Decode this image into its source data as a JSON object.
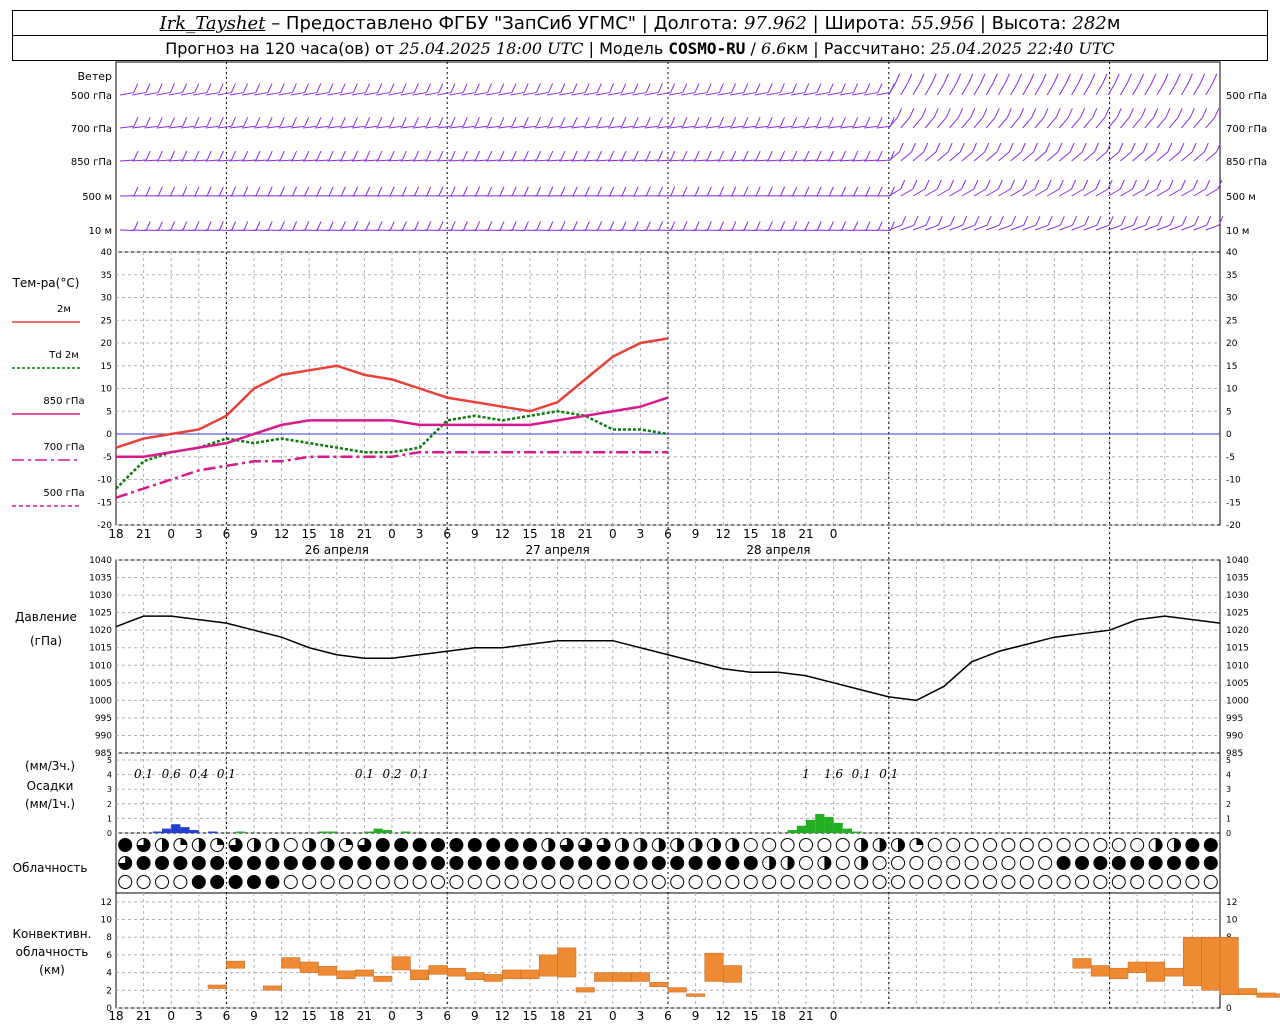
{
  "header": {
    "station": "Irk_Tayshet",
    "provided_by": "– Предоставлено ФГБУ \"ЗапСиб УГМС\"",
    "lon_label": "Долгота:",
    "lon_value": "97.962",
    "lat_label": "Широта:",
    "lat_value": "55.956",
    "alt_label": "Высота:",
    "alt_value": "282",
    "alt_unit": "м",
    "forecast_label": "Прогноз на 120 часа(ов) от",
    "forecast_start": "25.04.2025 18:00 UTC",
    "model_label": "Модель",
    "model_name": "COSMO-RU",
    "model_res": "6.6",
    "model_res_unit": "км",
    "calc_label": "Рассчитано:",
    "calc_time": "25.04.2025 22:40 UTC"
  },
  "labels": {
    "wind_title": "Ветер",
    "wind_levels": [
      "500 гПа",
      "700 гПа",
      "850 гПа",
      "500 м",
      "10 м"
    ],
    "temp_title": "Тем-ра(°C)",
    "temp_legend": [
      {
        "text": "2м",
        "color": "#e8413a",
        "dash": ""
      },
      {
        "text": "2м",
        "prefix": "Td",
        "color": "#0a7a0a",
        "dash": "3,2"
      },
      {
        "text": "850 гПа",
        "color": "#d81b8c",
        "dash": ""
      },
      {
        "text": "700 гПа",
        "color": "#d81b8c",
        "dash": "12,4,3,4"
      },
      {
        "text": "500 гПа",
        "color": "#d81b8c",
        "dash": "4,3"
      }
    ],
    "pressure_title": "Давление",
    "pressure_unit": "(гПа)",
    "precip_unit_3h": "(мм/3ч.)",
    "precip_title": "Осадки",
    "precip_unit_1h": "(мм/1ч.)",
    "cloud_title": "Облачность",
    "conv_title": [
      "Конвективн.",
      "облачность",
      "(км)"
    ],
    "hour_ticks": [
      "18",
      "21",
      "0",
      "3",
      "6",
      "9",
      "12",
      "15",
      "18",
      "21",
      "0",
      "3",
      "6",
      "9",
      "12",
      "15",
      "18",
      "21",
      "0",
      "3",
      "6",
      "9",
      "12",
      "15",
      "18",
      "21",
      "0"
    ],
    "day_labels": [
      {
        "text": "26 апреля",
        "at_index": 8
      },
      {
        "text": "27 апреля",
        "at_index": 16
      },
      {
        "text": "28 апреля",
        "at_index": 24
      }
    ]
  },
  "chart_data": [
    {
      "type": "wind-barbs",
      "title": "Ветер",
      "levels": [
        "500 гПа",
        "700 гПа",
        "850 гПа",
        "500 м",
        "10 м"
      ],
      "x_hours": [
        0,
        60
      ]
    },
    {
      "type": "line",
      "title": "Тем-ра(°C)",
      "ylim": [
        -20,
        40
      ],
      "yticks": [
        -20,
        -15,
        -10,
        -5,
        0,
        5,
        10,
        15,
        20,
        25,
        30,
        35,
        40
      ],
      "x_hours": [
        0,
        60
      ],
      "series": [
        {
          "name": "2м",
          "color": "#e8413a",
          "x": [
            0,
            3,
            6,
            9,
            12,
            15,
            18,
            21,
            24,
            27,
            30,
            33,
            36,
            39,
            42,
            45,
            48,
            51,
            54,
            57,
            60
          ],
          "y": [
            -3,
            -1,
            0,
            1,
            4,
            10,
            13,
            14,
            15,
            13,
            12,
            10,
            8,
            7,
            6,
            5,
            7,
            12,
            17,
            20,
            21
          ]
        },
        {
          "name": "Td 2м",
          "color": "#0a7a0a",
          "x": [
            0,
            3,
            6,
            9,
            12,
            15,
            18,
            21,
            24,
            27,
            30,
            33,
            36,
            39,
            42,
            45,
            48,
            51,
            54,
            57,
            60
          ],
          "y": [
            -12,
            -6,
            -4,
            -3,
            -1,
            -2,
            -1,
            -2,
            -3,
            -4,
            -4,
            -3,
            3,
            4,
            3,
            4,
            5,
            4,
            1,
            1,
            0
          ]
        },
        {
          "name": "850 гПа",
          "color": "#d81b8c",
          "x": [
            0,
            3,
            6,
            9,
            12,
            15,
            18,
            21,
            24,
            27,
            30,
            33,
            36,
            39,
            42,
            45,
            48,
            51,
            54,
            57,
            60
          ],
          "y": [
            -5,
            -5,
            -4,
            -3,
            -2,
            0,
            2,
            3,
            3,
            3,
            3,
            2,
            2,
            2,
            2,
            2,
            3,
            4,
            5,
            6,
            8
          ]
        },
        {
          "name": "700 гПа",
          "color": "#d81b8c",
          "x": [
            0,
            3,
            6,
            9,
            12,
            15,
            18,
            21,
            24,
            27,
            30,
            33,
            36,
            39,
            42,
            45,
            48,
            51,
            54,
            57,
            60
          ],
          "y": [
            -14,
            -12,
            -10,
            -8,
            -7,
            -6,
            -6,
            -5,
            -5,
            -5,
            -5,
            -4,
            -4,
            -4,
            -4,
            -4,
            -4,
            -4,
            -4,
            -4,
            -4
          ]
        },
        {
          "name": "500 гПа",
          "color": "#d81b8c",
          "x": [],
          "y": []
        }
      ]
    },
    {
      "type": "line",
      "title": "Давление",
      "ylabel": "(гПа)",
      "ylim": [
        985,
        1040
      ],
      "yticks": [
        985,
        990,
        995,
        1000,
        1005,
        1010,
        1015,
        1020,
        1025,
        1030,
        1035,
        1040
      ],
      "series": [
        {
          "name": "Давление",
          "color": "#000000",
          "x": [
            0,
            3,
            6,
            9,
            12,
            15,
            18,
            21,
            24,
            27,
            30,
            33,
            36,
            39,
            42,
            45,
            48,
            51,
            54,
            57,
            60,
            63,
            66,
            69,
            72,
            75,
            78,
            81,
            84,
            87,
            90,
            93,
            96,
            99,
            102,
            105,
            108,
            111,
            114,
            117,
            120
          ],
          "y": [
            1021,
            1024,
            1024,
            1023,
            1022,
            1020,
            1018,
            1015,
            1013,
            1012,
            1012,
            1013,
            1014,
            1015,
            1015,
            1016,
            1017,
            1017,
            1017,
            1015,
            1013,
            1011,
            1009,
            1008,
            1008,
            1007,
            1005,
            1003,
            1001,
            1000,
            1004,
            1011,
            1014,
            1016,
            1018,
            1019,
            1020,
            1023,
            1024,
            1023,
            1022
          ]
        }
      ]
    },
    {
      "type": "bar",
      "title": "Осадки",
      "ylim": [
        0,
        5
      ],
      "yticks": [
        0,
        1,
        2,
        3,
        4,
        5
      ],
      "amount_labels": [
        {
          "hour": 3,
          "text": "0.1"
        },
        {
          "hour": 6,
          "text": "0.6"
        },
        {
          "hour": 9,
          "text": "0.4"
        },
        {
          "hour": 12,
          "text": "0.1"
        },
        {
          "hour": 27,
          "text": "0.1"
        },
        {
          "hour": 30,
          "text": "0.2"
        },
        {
          "hour": 33,
          "text": "0.1"
        },
        {
          "hour": 75,
          "text": "1"
        },
        {
          "hour": 78,
          "text": "1.6"
        },
        {
          "hour": 81,
          "text": "0.1"
        },
        {
          "hour": 84,
          "text": "0.1"
        }
      ],
      "bars": [
        {
          "hour": 4,
          "value": 0.1,
          "color": "#1e3fd0"
        },
        {
          "hour": 5,
          "value": 0.3,
          "color": "#1e3fd0"
        },
        {
          "hour": 6,
          "value": 0.6,
          "color": "#1e3fd0"
        },
        {
          "hour": 7,
          "value": 0.4,
          "color": "#1e3fd0"
        },
        {
          "hour": 8,
          "value": 0.2,
          "color": "#1e3fd0"
        },
        {
          "hour": 10,
          "value": 0.1,
          "color": "#1e3fd0"
        },
        {
          "hour": 13,
          "value": 0.1,
          "color": "#22b022"
        },
        {
          "hour": 22,
          "value": 0.1,
          "color": "#22b022"
        },
        {
          "hour": 23,
          "value": 0.1,
          "color": "#22b022"
        },
        {
          "hour": 27,
          "value": 0.1,
          "color": "#22b022"
        },
        {
          "hour": 28,
          "value": 0.3,
          "color": "#22b022"
        },
        {
          "hour": 29,
          "value": 0.2,
          "color": "#22b022"
        },
        {
          "hour": 31,
          "value": 0.1,
          "color": "#22b022"
        },
        {
          "hour": 73,
          "value": 0.2,
          "color": "#22b022"
        },
        {
          "hour": 74,
          "value": 0.5,
          "color": "#22b022"
        },
        {
          "hour": 75,
          "value": 0.9,
          "color": "#22b022"
        },
        {
          "hour": 76,
          "value": 1.3,
          "color": "#22b022"
        },
        {
          "hour": 77,
          "value": 1.1,
          "color": "#22b022"
        },
        {
          "hour": 78,
          "value": 0.7,
          "color": "#22b022"
        },
        {
          "hour": 79,
          "value": 0.3,
          "color": "#22b022"
        },
        {
          "hour": 80,
          "value": 0.1,
          "color": "#22b022"
        }
      ]
    },
    {
      "type": "heatmap",
      "title": "Облачность",
      "rows": 3,
      "cols": 60,
      "note": "cloud cover symbols: 0 empty, 1 quarter, 2 half, 3 three-quarter, 4 full",
      "row_values": [
        [
          4,
          3,
          2,
          1,
          2,
          1,
          3,
          2,
          2,
          0,
          2,
          2,
          1,
          3,
          4,
          4,
          4,
          4,
          4,
          4,
          4,
          4,
          4,
          2,
          3,
          3,
          3,
          2,
          2,
          2,
          2,
          2,
          2,
          2,
          0,
          0,
          0,
          0,
          0,
          0,
          2,
          2,
          2,
          1,
          0,
          0,
          0,
          0,
          0,
          0,
          0,
          0,
          0,
          0,
          0,
          0,
          2,
          2,
          4,
          4
        ],
        [
          3,
          4,
          4,
          4,
          4,
          4,
          4,
          4,
          4,
          4,
          4,
          4,
          4,
          4,
          4,
          4,
          4,
          4,
          4,
          4,
          4,
          4,
          4,
          4,
          4,
          4,
          4,
          4,
          4,
          4,
          4,
          4,
          4,
          4,
          4,
          2,
          2,
          0,
          2,
          0,
          2,
          0,
          0,
          0,
          0,
          0,
          0,
          0,
          0,
          0,
          0,
          4,
          4,
          4,
          4,
          4,
          4,
          4,
          4,
          4
        ],
        [
          0,
          0,
          0,
          0,
          4,
          4,
          4,
          4,
          4,
          0,
          0,
          0,
          0,
          0,
          0,
          0,
          0,
          0,
          0,
          0,
          0,
          0,
          0,
          0,
          0,
          0,
          0,
          0,
          0,
          0,
          0,
          0,
          0,
          0,
          0,
          0,
          0,
          0,
          0,
          0,
          0,
          0,
          0,
          0,
          0,
          0,
          0,
          0,
          0,
          0,
          0,
          0,
          0,
          0,
          0,
          0,
          0,
          0,
          0,
          0
        ]
      ]
    },
    {
      "type": "bar",
      "title": "Конвективн. облачность (км)",
      "ylim": [
        0,
        13
      ],
      "yticks": [
        0,
        2,
        4,
        6,
        8,
        10,
        12
      ],
      "bars": [
        {
          "hour": 5,
          "base": 2.2,
          "top": 2.6
        },
        {
          "hour": 6,
          "base": 4.5,
          "top": 5.3
        },
        {
          "hour": 8,
          "base": 2.0,
          "top": 2.5
        },
        {
          "hour": 9,
          "base": 4.5,
          "top": 5.7
        },
        {
          "hour": 10,
          "base": 4.0,
          "top": 5.2
        },
        {
          "hour": 11,
          "base": 3.7,
          "top": 4.7
        },
        {
          "hour": 12,
          "base": 3.3,
          "top": 4.2
        },
        {
          "hour": 13,
          "base": 3.6,
          "top": 4.3
        },
        {
          "hour": 14,
          "base": 3.0,
          "top": 3.6
        },
        {
          "hour": 15,
          "base": 4.3,
          "top": 5.8
        },
        {
          "hour": 16,
          "base": 3.2,
          "top": 4.3
        },
        {
          "hour": 17,
          "base": 3.8,
          "top": 4.8
        },
        {
          "hour": 18,
          "base": 3.6,
          "top": 4.5
        },
        {
          "hour": 19,
          "base": 3.2,
          "top": 4.0
        },
        {
          "hour": 20,
          "base": 3.0,
          "top": 3.8
        },
        {
          "hour": 21,
          "base": 3.3,
          "top": 4.3
        },
        {
          "hour": 22,
          "base": 3.3,
          "top": 4.3
        },
        {
          "hour": 23,
          "base": 3.6,
          "top": 6.0
        },
        {
          "hour": 24,
          "base": 3.5,
          "top": 6.8
        },
        {
          "hour": 25,
          "base": 1.8,
          "top": 2.3
        },
        {
          "hour": 26,
          "base": 3.0,
          "top": 4.0
        },
        {
          "hour": 27,
          "base": 3.0,
          "top": 4.0
        },
        {
          "hour": 28,
          "base": 3.0,
          "top": 4.0
        },
        {
          "hour": 29,
          "base": 2.4,
          "top": 2.9
        },
        {
          "hour": 30,
          "base": 1.8,
          "top": 2.3
        },
        {
          "hour": 31,
          "base": 1.3,
          "top": 1.6
        },
        {
          "hour": 32,
          "base": 3.0,
          "top": 6.2
        },
        {
          "hour": 33,
          "base": 2.9,
          "top": 4.8
        },
        {
          "hour": 52,
          "base": 4.5,
          "top": 5.6
        },
        {
          "hour": 53,
          "base": 3.6,
          "top": 4.8
        },
        {
          "hour": 54,
          "base": 3.3,
          "top": 4.5
        },
        {
          "hour": 55,
          "base": 4.0,
          "top": 5.2
        },
        {
          "hour": 56,
          "base": 3.0,
          "top": 5.2
        },
        {
          "hour": 57,
          "base": 3.6,
          "top": 4.5
        },
        {
          "hour": 58,
          "base": 2.5,
          "top": 8.0
        },
        {
          "hour": 59,
          "base": 2.0,
          "top": 8.0
        },
        {
          "hour": 60,
          "base": 1.5,
          "top": 8.0
        },
        {
          "hour": 61,
          "base": 1.5,
          "top": 2.2
        },
        {
          "hour": 62,
          "base": 1.2,
          "top": 1.7
        },
        {
          "hour": 63,
          "base": 1.2,
          "top": 1.6
        },
        {
          "hour": 64,
          "base": 1.2,
          "top": 1.6
        },
        {
          "hour": 65,
          "base": 1.3,
          "top": 1.7
        },
        {
          "hour": 66,
          "base": 1.3,
          "top": 1.7
        },
        {
          "hour": 67,
          "base": 1.4,
          "top": 1.8
        },
        {
          "hour": 68,
          "base": 1.3,
          "top": 1.7
        },
        {
          "hour": 69,
          "base": 1.3,
          "top": 1.7
        },
        {
          "hour": 70,
          "base": 1.4,
          "top": 1.7
        },
        {
          "hour": 71,
          "base": 1.2,
          "top": 1.5
        },
        {
          "hour": 76,
          "base": 1.3,
          "top": 1.6
        },
        {
          "hour": 77,
          "base": 1.3,
          "top": 1.6
        }
      ]
    }
  ],
  "colors": {
    "temp_2m": "#e8413a",
    "dewpoint": "#0a7a0a",
    "upper_temp": "#d81b8c",
    "wind": "#8a2be2",
    "zero_line": "#3a3ad0",
    "conv": "#ee8a33"
  }
}
